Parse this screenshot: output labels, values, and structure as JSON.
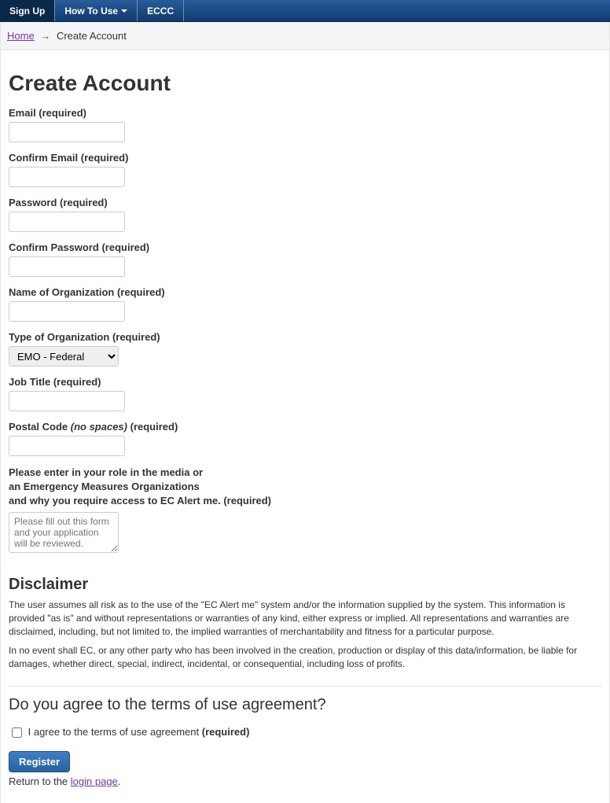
{
  "nav": {
    "signup": "Sign Up",
    "howto": "How To Use",
    "eccc": "ECCC"
  },
  "breadcrumb": {
    "home": "Home",
    "sep": "→",
    "current": "Create Account"
  },
  "page_title": "Create Account",
  "fields": {
    "email_label": "Email ",
    "email_req": "(required)",
    "confirm_email_label": "Confirm Email ",
    "confirm_email_req": "(required)",
    "password_label": "Password ",
    "password_req": "(required)",
    "confirm_password_label": "Confirm Password ",
    "confirm_password_req": "(required)",
    "org_name_label": "Name of Organization ",
    "org_name_req": "(required)",
    "org_type_label": "Type of Organization ",
    "org_type_req": "(required)",
    "org_type_selected": "EMO - Federal",
    "job_title_label": "Job Title ",
    "job_title_req": "(required)",
    "postal_label_a": "Postal Code ",
    "postal_label_b": "(no spaces)",
    "postal_req": " (required)",
    "role_line1": "Please enter in your role in the media or",
    "role_line2": "an Emergency Measures Organizations",
    "role_line3_a": "and why you require access to EC Alert me. ",
    "role_line3_req": "(required)",
    "role_placeholder": "Please fill out this form and your application will be reviewed."
  },
  "disclaimer": {
    "title": "Disclaimer",
    "p1": "The user assumes all risk as to the use of the \"EC Alert me\" system and/or the information supplied by the system. This information is provided \"as is\" and without representations or warranties of any kind, either express or implied. All representations and warranties are disclaimed, including, but not limited to, the implied warranties of merchantability and fitness for a particular purpose.",
    "p2": "In no event shall EC, or any other party who has been involved in the creation, production or display of this data/information, be liable for damages, whether direct, special, indirect, incidental, or consequential, including loss of profits."
  },
  "agree": {
    "heading": "Do you agree to the terms of use agreement?",
    "checkbox_label": " I agree to the terms of use agreement ",
    "checkbox_req": "(required)"
  },
  "actions": {
    "register": "Register",
    "return_prefix": "Return to the ",
    "login_link": "login page",
    "return_suffix": "."
  }
}
